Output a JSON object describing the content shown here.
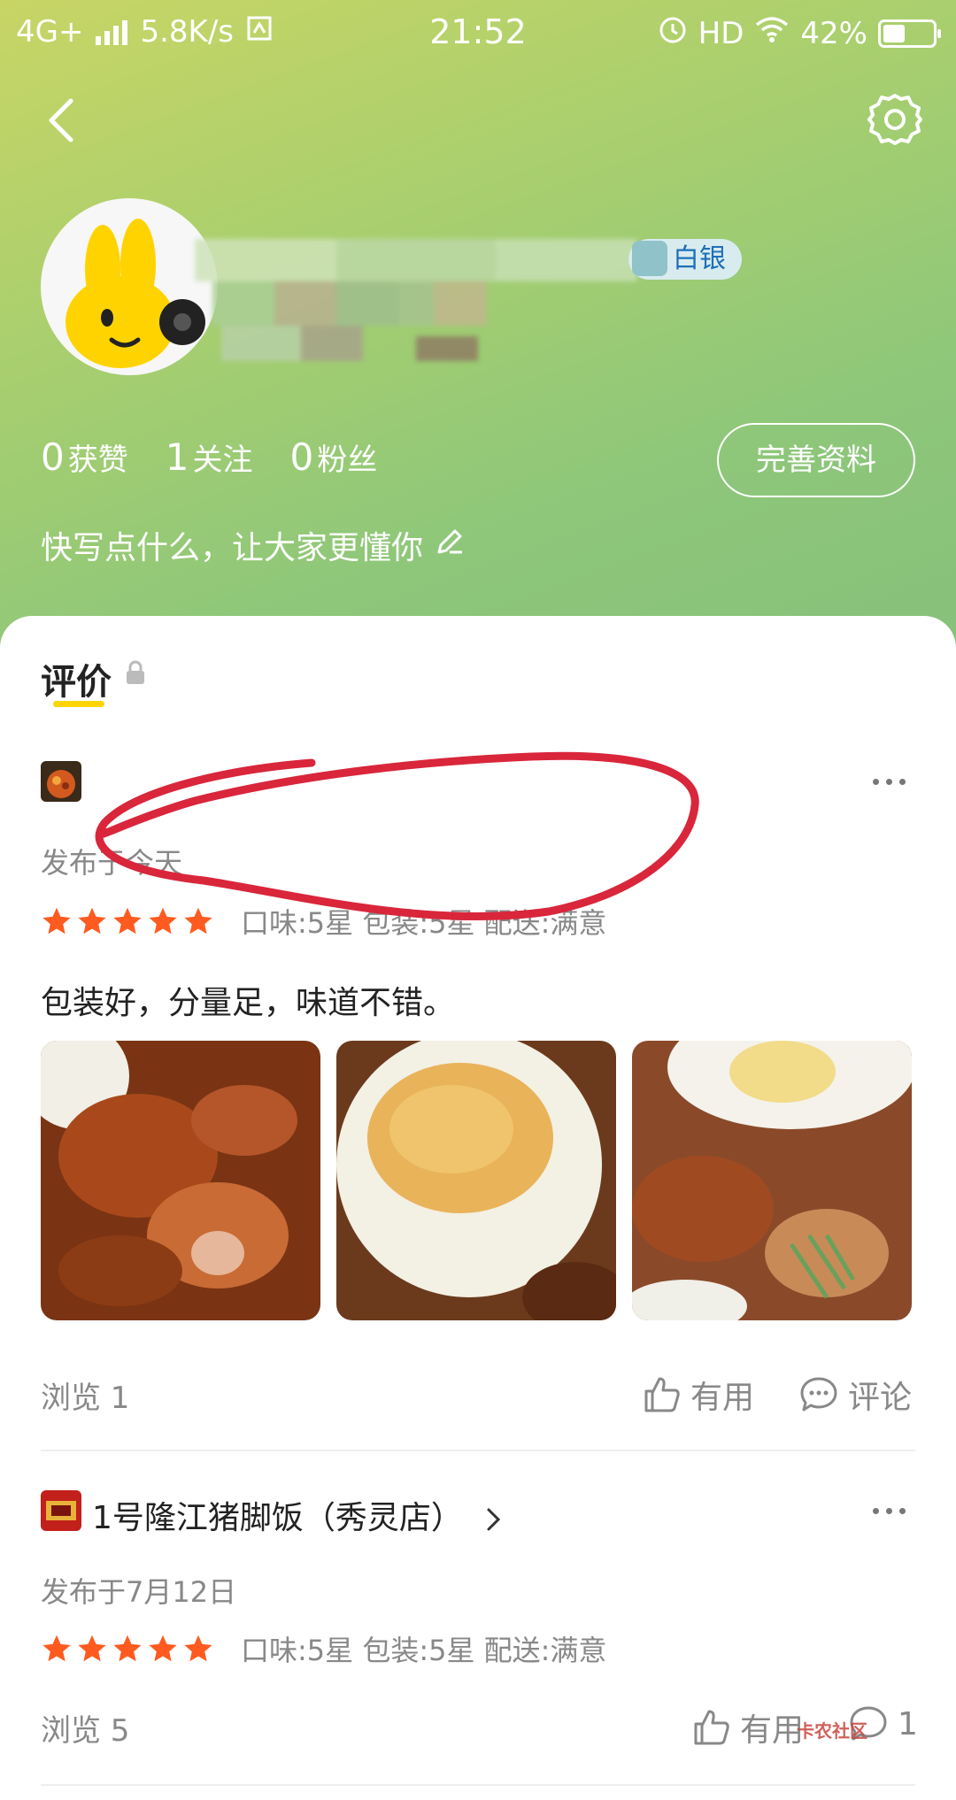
{
  "status_bar": {
    "network": "4G+",
    "speed": "5.8K/s",
    "time": "21:52",
    "hd": "HD",
    "battery": "42%",
    "battery_level": 0.42
  },
  "profile": {
    "level_badge": "白银",
    "stats": [
      {
        "num": "0",
        "label": "获赞"
      },
      {
        "num": "1",
        "label": "关注"
      },
      {
        "num": "0",
        "label": "粉丝"
      }
    ],
    "edit_button": "完善资料",
    "bio": "快写点什么，让大家更懂你"
  },
  "tabs": {
    "reviews": "评价"
  },
  "reviews": [
    {
      "store": "",
      "date": "发布于今天",
      "stars": 5,
      "rating_detail": "口味:5星 包装:5星 配送:满意",
      "text": "包装好，分量足，味道不错。",
      "views": "浏览 1",
      "useful": "有用",
      "comment": "评论"
    },
    {
      "store": "1号隆江猪脚饭（秀灵店）",
      "date": "发布于7月12日",
      "stars": 5,
      "rating_detail": "口味:5星 包装:5星 配送:满意",
      "views": "浏览 5",
      "useful": "有用",
      "comment_count": "1"
    }
  ],
  "watermark": "卡农社区",
  "colors": {
    "accent_yellow": "#ffd400",
    "star": "#ff5a1f",
    "annotation_red": "#d9263b",
    "badge_text": "#1d6fb8"
  }
}
